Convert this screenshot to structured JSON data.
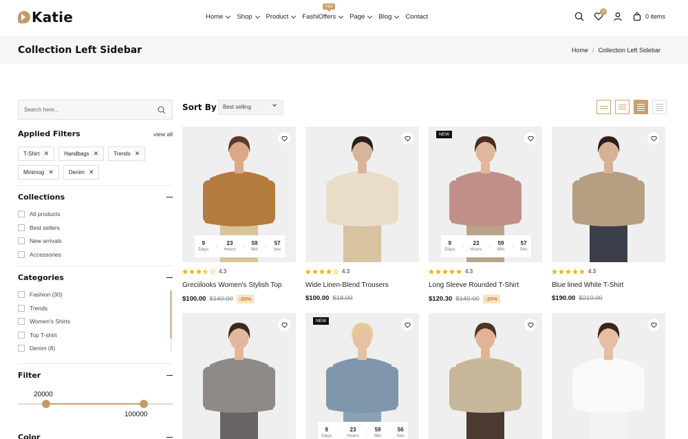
{
  "header": {
    "logo_text": "Katie",
    "nav": [
      {
        "label": "Home",
        "chevron": true
      },
      {
        "label": "Shop",
        "chevron": true
      },
      {
        "label": "Product",
        "chevron": true
      },
      {
        "label": "FashiOffers",
        "chevron": true,
        "badge": "Hot"
      },
      {
        "label": "Page",
        "chevron": true
      },
      {
        "label": "Blog",
        "chevron": true
      },
      {
        "label": "Contact",
        "chevron": false
      }
    ],
    "wishlist_count": "2",
    "cart_text": "0 items"
  },
  "titlebar": {
    "title": "Collection Left Sidebar",
    "breadcrumb_home": "Home",
    "breadcrumb_sep": "/",
    "breadcrumb_current": "Collection Left Sidebar"
  },
  "sidebar": {
    "search_placeholder": "Search here...",
    "applied_title": "Applied Filters",
    "view_all": "view all",
    "chips": [
      "T-Shirt",
      "Handbags",
      "Trends",
      "Minimog",
      "Denim"
    ],
    "collections_title": "Collections",
    "collections": [
      "All products",
      "Best sellers",
      "New arrivals",
      "Accessories"
    ],
    "categories_title": "Categories",
    "categories": [
      "Fashion (30)",
      "Trends",
      "Women's Shirts",
      "Top T-shirt",
      "Denim (8)"
    ],
    "filter_title": "Filter",
    "price_min": "20000",
    "price_max": "100000",
    "color_title": "Color"
  },
  "toolbar": {
    "sort_label": "Sort By :",
    "sort_value": "Best selling"
  },
  "timer_labels": {
    "days": "Days",
    "hours": "Hours",
    "min": "Min",
    "sec": "Sec"
  },
  "products": [
    {
      "name": "Greciilooks Women's Stylish Top",
      "price": "$100.00",
      "old": "$140.00",
      "off": "-20%",
      "rating": "4.3",
      "stars": 3.5,
      "timer": {
        "days": "9",
        "hours": "23",
        "min": "59",
        "sec": "57"
      }
    },
    {
      "name": "Wide Linen-Blend Trousers",
      "price": "$100.00",
      "old": "$18.00",
      "rating": "4.3",
      "stars": 4
    },
    {
      "name": "Long Sleeve Rounded T-Shirt",
      "price": "$120.30",
      "old": "$140.00",
      "off": "-20%",
      "rating": "4.3",
      "stars": 5,
      "badge": "NEW",
      "timer": {
        "days": "9",
        "hours": "23",
        "min": "59",
        "sec": "57"
      }
    },
    {
      "name": "Blue lined White T-Shirt",
      "price": "$190.00",
      "old": "$210.00",
      "rating": "4.3",
      "stars": 5
    },
    {
      "badge": ""
    },
    {
      "badge": "NEW",
      "timer": {
        "days": "9",
        "hours": "23",
        "min": "59",
        "sec": "56"
      }
    },
    {
      "badge": ""
    },
    {
      "badge": ""
    }
  ],
  "colors": {
    "accent": "#c8a06f",
    "badge_off_bg": "#f7e3c9",
    "star": "#f5b301"
  }
}
